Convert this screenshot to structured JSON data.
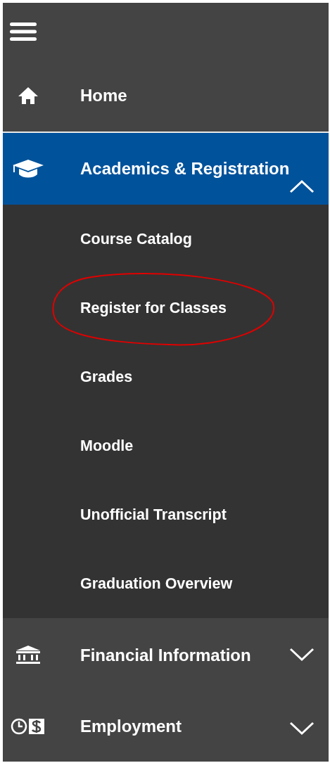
{
  "nav_items": [
    {
      "kind": "link",
      "label": "Home",
      "selected": false
    },
    {
      "kind": "group",
      "label": "Academics & Registration",
      "selected": true,
      "expanded": true,
      "children": [
        {
          "label": "Course Catalog",
          "circled": false
        },
        {
          "label": "Register for Classes",
          "circled": true
        },
        {
          "label": "Grades",
          "circled": false
        },
        {
          "label": "Moodle",
          "circled": false
        },
        {
          "label": "Unofficial Transcript",
          "circled": false
        },
        {
          "label": "Graduation Overview",
          "circled": false
        }
      ]
    },
    {
      "kind": "group",
      "label": "Financial Information",
      "selected": false,
      "expanded": false
    },
    {
      "kind": "group",
      "label": "Employment",
      "selected": false,
      "expanded": false
    }
  ]
}
